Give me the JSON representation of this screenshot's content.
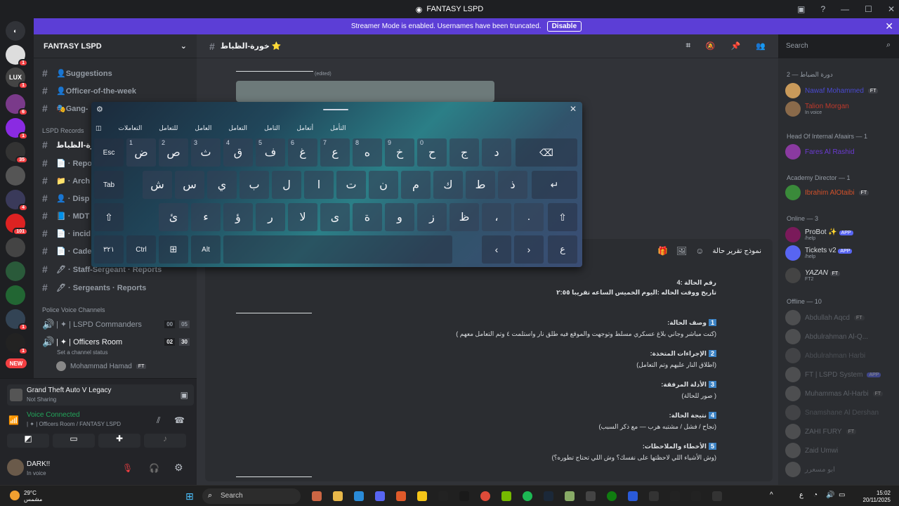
{
  "window": {
    "title": "FANTASY LSPD"
  },
  "banner": {
    "text": "Streamer Mode is enabled. Usernames have been truncated.",
    "button": "Disable"
  },
  "server": {
    "name": "FANTASY LSPD"
  },
  "channels": [
    {
      "name": "👤Suggestions"
    },
    {
      "name": "👤Officer-of-the-week"
    },
    {
      "name": "🎭Gang-"
    },
    {
      "name": "خورة-الظباط",
      "category": "LSPD Records"
    },
    {
      "name": "📄 · Repo"
    },
    {
      "name": "📁 · Arch"
    },
    {
      "name": "👤 · Disp"
    },
    {
      "name": "📘 · MDT"
    },
    {
      "name": "📄 · incid"
    },
    {
      "name": "📄 · Cade"
    },
    {
      "name": "🖊 · Staff-Sergeant · Reports"
    },
    {
      "name": "🖊 · Sergeants · Reports"
    }
  ],
  "voice_category": "Police Voice Channels",
  "voice_channels": [
    {
      "name": "| ✦ | LSPD Commanders",
      "a": "00",
      "b": "05"
    },
    {
      "name": "| ✦ | Officers Room",
      "a": "02",
      "b": "30",
      "status": "Set a channel status",
      "member": "Mohammad Hamad",
      "tag": "FT"
    }
  ],
  "activity": {
    "game": "Grand Theft Auto V Legacy",
    "sub": "Not Sharing"
  },
  "voice": {
    "status": "Voice Connected",
    "where": "| ✦ | Officers Room / FANTASY LSPD"
  },
  "user": {
    "name": "DARK!!",
    "status": "In voice"
  },
  "channel_header": {
    "name": "خورة-الظباط ⭐"
  },
  "search": {
    "placeholder": "Search"
  },
  "members": {
    "cat1": "دورة الضباط — 2",
    "m1": {
      "name": "Nawaf Mohammed",
      "tag": "FT"
    },
    "m2": {
      "name": "Talion Morgan",
      "sub": "In voice"
    },
    "cat2": "Head Of Internal Afaairs — 1",
    "m3": {
      "name": "Fares Al Rashid"
    },
    "cat3": "Academy Director — 1",
    "m4": {
      "name": "Ibrahim AlOtaibi",
      "tag": "FT"
    },
    "cat4": "Online — 3",
    "m5": {
      "name": "ProBot ✨",
      "tag": "APP",
      "sub": "/help"
    },
    "m6": {
      "name": "Tickets v2",
      "tag": "APP",
      "sub": "/help"
    },
    "m7": {
      "name": "YAZAN",
      "tag": "FT",
      "sub": "FT2"
    },
    "cat5": "Offline — 10",
    "m8": {
      "name": "Abdullah Aqcd",
      "tag": "FT"
    },
    "m9": {
      "name": "Abdulrahman Al-Q..."
    },
    "m10": {
      "name": "Abdulrahman Harbi"
    },
    "m11": {
      "name": "FT | LSPD System",
      "tag": "APP"
    },
    "m12": {
      "name": "Muhammas Al-Harbi",
      "tag": "FT"
    },
    "m13": {
      "name": "Snamshane Al Dershan"
    },
    "m14": {
      "name": "ZAHI FURY",
      "tag": "FT"
    },
    "m15": {
      "name": "Zaid Umwi"
    },
    "m16": {
      "name": "ابو مسعرر"
    }
  },
  "thread": {
    "title": "نموذج تقرير حالة",
    "l1": "رقم الحالة :4",
    "l2": "تاريخ ووقت الحاله :اليوم الخميس الساعه تقريبا ٢:٥٥",
    "h1": "وصف الحالة:",
    "n1": "1",
    "t1": "(كنت مباشر وجاني بلاغ عسكري مسلط وتوجهت والموقع فيه طلق نار واستلمت ٤ وتم التعامل معهم )",
    "h2": "الإجراءات المتخذة:",
    "n2": "2",
    "t2": "(اطلاق النار عليهم وتم التعامل)",
    "h3": "الأدلة المرفقة:",
    "n3": "3",
    "t3": "( صور للحالة)",
    "h4": "نتيجة الحالة:",
    "n4": "4",
    "t4": "(نجاح / فشل / مشتبه هرب — مع ذكر السبب)",
    "h5": "الأخطاء والملاحظات:",
    "n5": "5",
    "t5": "(وش الأشياء اللي لاحظتها على نفسك؟ وش اللي تحتاج تطوره؟)",
    "rule": "_______________",
    "edited": "(edited)"
  },
  "keyboard": {
    "suggestions": [
      "التعاملات",
      "للتعامل",
      "العامل",
      "التعامل",
      "التامل",
      "أتعامل",
      "التأمل"
    ],
    "row1": [
      {
        "s": "1",
        "k": "ض"
      },
      {
        "s": "2",
        "k": "ص"
      },
      {
        "s": "3",
        "k": "ث"
      },
      {
        "s": "4",
        "k": "ق"
      },
      {
        "s": "5",
        "k": "ف"
      },
      {
        "s": "6",
        "k": "غ"
      },
      {
        "s": "7",
        "k": "ع"
      },
      {
        "s": "8",
        "k": "ه"
      },
      {
        "s": "9",
        "k": "خ"
      },
      {
        "s": "0",
        "k": "ح"
      },
      {
        "s": "",
        "k": "ج"
      },
      {
        "s": "",
        "k": "د"
      }
    ],
    "row2": [
      "ش",
      "س",
      "ي",
      "ب",
      "ل",
      "ا",
      "ت",
      "ن",
      "م",
      "ك",
      "ط",
      "ذ"
    ],
    "row3": [
      "ئ",
      "ء",
      "ؤ",
      "ر",
      "لا",
      "ى",
      "ة",
      "و",
      "ز",
      "ظ",
      "،",
      "."
    ],
    "esc": "Esc",
    "tab": "Tab",
    "ctrl": "Ctrl",
    "alt": "Alt",
    "nums": "٣٢١",
    "lang": "ع"
  },
  "taskbar": {
    "temp": "29°C",
    "cond": "مشمس",
    "search": "Search",
    "time": "15:02",
    "date": "20/11/2025",
    "lang": "ع"
  }
}
